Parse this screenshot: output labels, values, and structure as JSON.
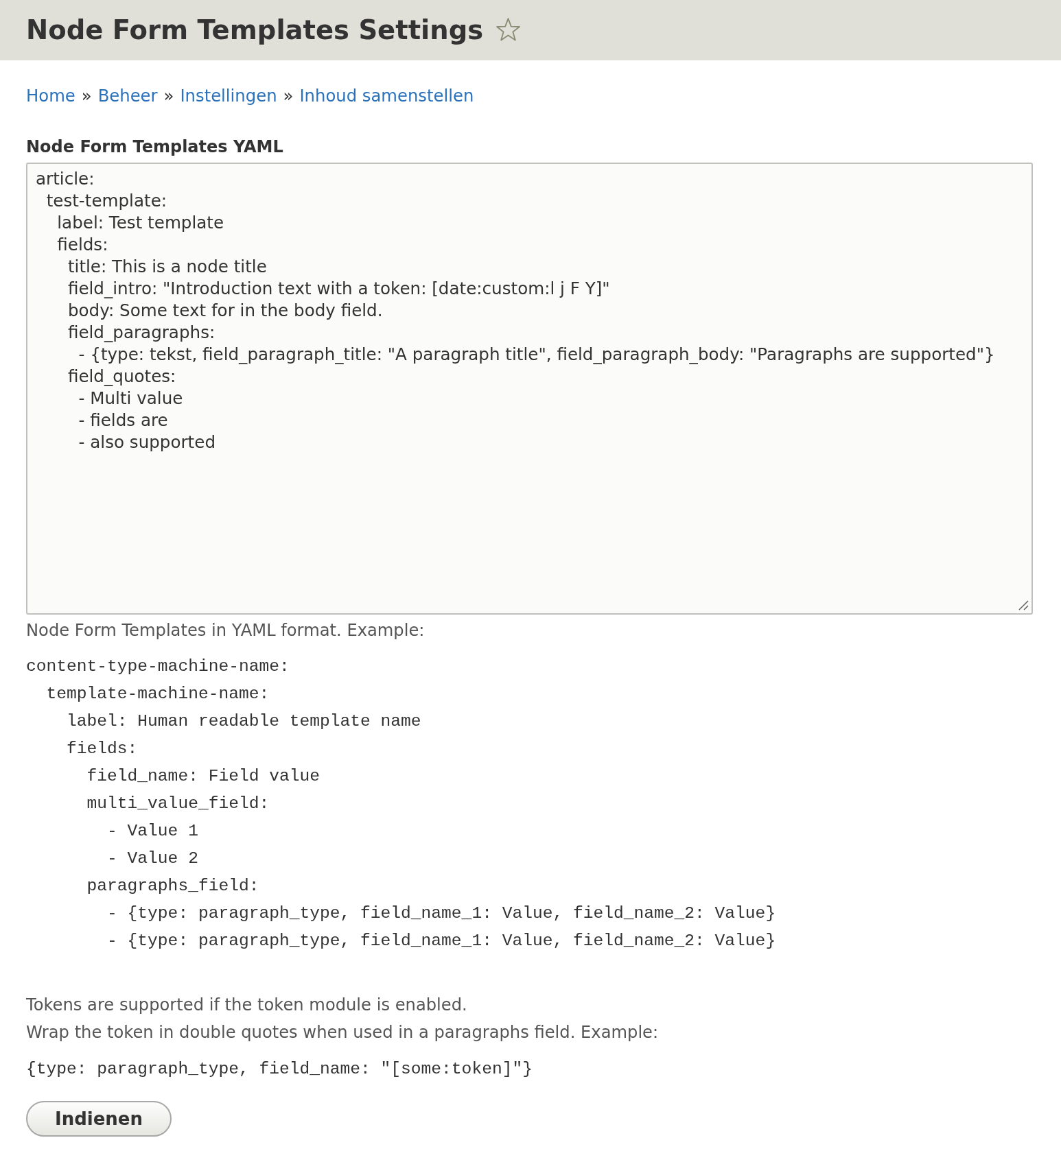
{
  "page_title": "Node Form Templates Settings",
  "breadcrumb": [
    {
      "kind": "link",
      "text": "Home"
    },
    {
      "kind": "separator",
      "text": "»"
    },
    {
      "kind": "link",
      "text": "Beheer"
    },
    {
      "kind": "separator",
      "text": "»"
    },
    {
      "kind": "link",
      "text": "Instellingen"
    },
    {
      "kind": "separator",
      "text": "»"
    },
    {
      "kind": "link",
      "text": "Inhoud samenstellen"
    }
  ],
  "yaml_field": {
    "label": "Node Form Templates YAML",
    "value": "article:\n  test-template:\n    label: Test template\n    fields:\n      title: This is a node title\n      field_intro: \"Introduction text with a token: [date:custom:l j F Y]\"\n      body: Some text for in the body field.\n      field_paragraphs:\n        - {type: tekst, field_paragraph_title: \"A paragraph title\", field_paragraph_body: \"Paragraphs are supported\"}\n      field_quotes:\n        - Multi value\n        - fields are\n        - also supported"
  },
  "description": {
    "intro": "Node Form Templates in YAML format. Example:",
    "example_code": "content-type-machine-name:\n  template-machine-name:\n    label: Human readable template name\n    fields:\n      field_name: Field value\n      multi_value_field:\n        - Value 1\n        - Value 2\n      paragraphs_field:\n        - {type: paragraph_type, field_name_1: Value, field_name_2: Value}\n        - {type: paragraph_type, field_name_1: Value, field_name_2: Value}",
    "notes": [
      "Tokens are supported if the token module is enabled.",
      "Wrap the token in double quotes when used in a paragraphs field. Example:"
    ],
    "token_example": "{type: paragraph_type, field_name: \"[some:token]\"}"
  },
  "submit_button": {
    "label": "Indienen"
  }
}
